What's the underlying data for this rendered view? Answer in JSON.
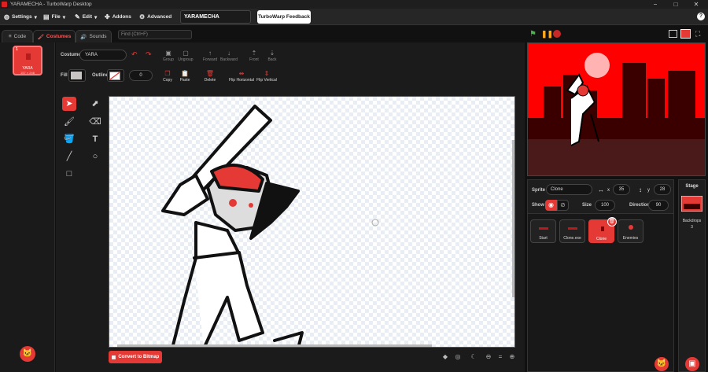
{
  "window": {
    "title": "YARAMECHA - TurboWarp Desktop",
    "min": "−",
    "max": "□",
    "close": "✕"
  },
  "menu": {
    "settings": "Settings",
    "file": "File",
    "edit": "Edit",
    "addons": "Addons",
    "advanced": "Advanced",
    "project_title": "YARAMECHA",
    "feedback": "TurboWarp Feedback",
    "help": "?"
  },
  "tabs": {
    "code": "Code",
    "costumes": "Costumes",
    "sounds": "Sounds",
    "find_placeholder": "Find (Ctrl+F)"
  },
  "costume_list": [
    {
      "number": "1",
      "name": "YARA",
      "size": "157 × 246"
    }
  ],
  "paint": {
    "costume_label": "Costume",
    "costume_name": "YARA",
    "fill_label": "Fill",
    "outline_label": "Outline",
    "outline_width": "0",
    "toolbar_top": [
      "Group",
      "Ungroup",
      "Forward",
      "Backward",
      "Front",
      "Back"
    ],
    "toolbar_bottom": [
      "Copy",
      "Paste",
      "Delete",
      "Flip Horizontal",
      "Flip Vertical"
    ],
    "fill_color": "#c9c4c4",
    "accent": "#e53935",
    "convert_label": "Convert to Bitmap"
  },
  "stage_controls": {
    "green_flag": "green-flag-icon",
    "pause": "pause-icon",
    "stop": "stop-icon"
  },
  "sprite_info": {
    "sprite_label": "Sprite",
    "sprite_name": "Clone",
    "x": "35",
    "y": "28",
    "show_label": "Show",
    "size_label": "Size",
    "size": "100",
    "direction_label": "Direction",
    "direction": "90"
  },
  "sprites": [
    {
      "name": "Start"
    },
    {
      "name": "Clone.exe"
    },
    {
      "name": "Clone"
    },
    {
      "name": "Enemies"
    }
  ],
  "stage_pane": {
    "title": "Stage",
    "backdrops_label": "Backdrops",
    "backdrops_count": "3"
  }
}
